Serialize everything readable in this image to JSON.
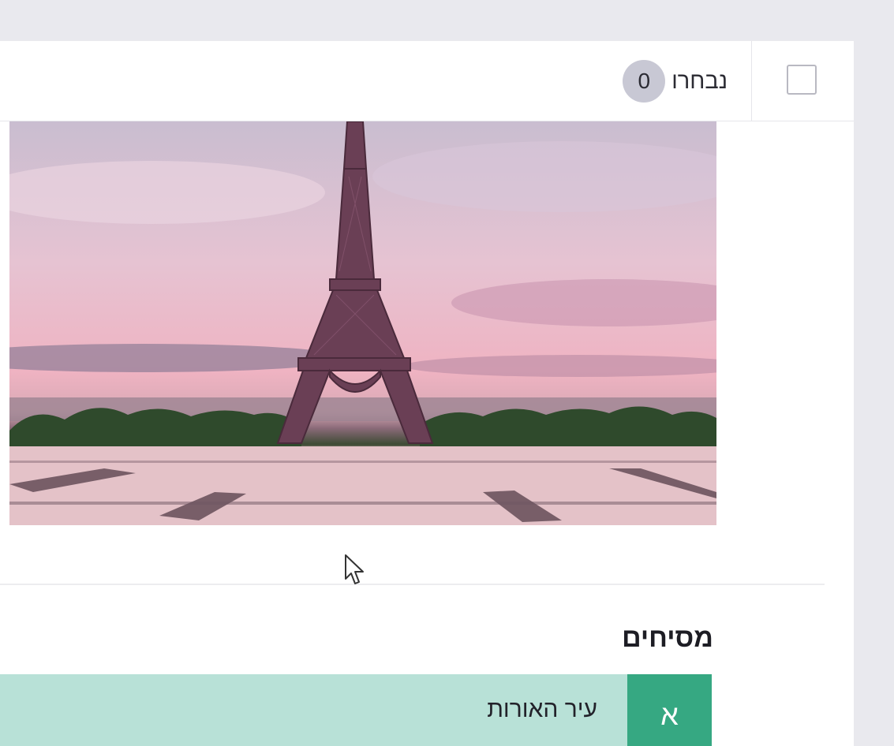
{
  "header": {
    "selected_label": "נבחרו",
    "selected_count": "0"
  },
  "section": {
    "title": "מסיחים"
  },
  "options": [
    {
      "letter": "א",
      "text": "עיר האורות"
    }
  ],
  "colors": {
    "page_bg": "#e9e9ee",
    "card_bg": "#ffffff",
    "badge_bg": "#c8c8d4",
    "option_bg": "#b8e1d7",
    "option_letter_bg": "#36a882"
  },
  "icons": {
    "checkbox": "checkbox-empty-icon",
    "cursor": "mouse-pointer-icon"
  }
}
